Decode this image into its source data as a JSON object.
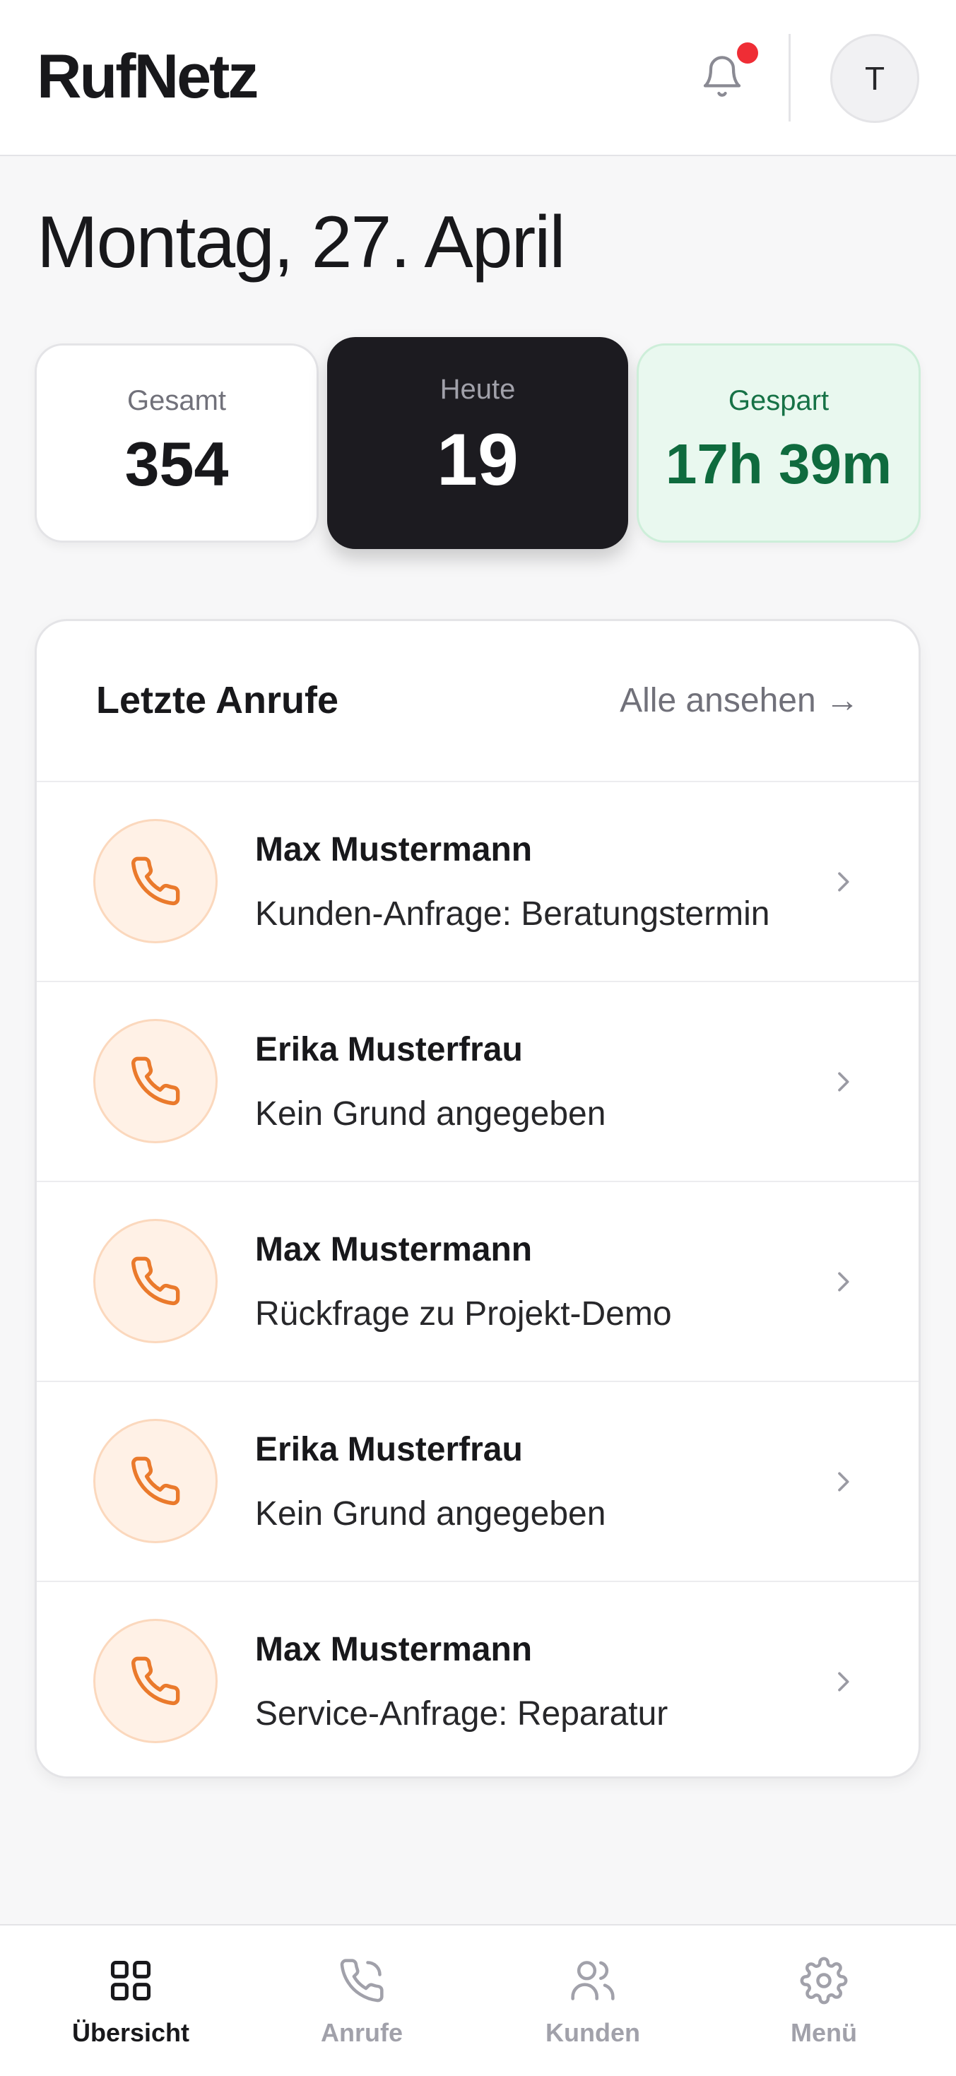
{
  "header": {
    "brand": "RufNetz",
    "avatar_initial": "T",
    "notification_dot_color": "#ef2d35"
  },
  "date_heading": "Montag, 27. April",
  "stats": {
    "total": {
      "label": "Gesamt",
      "value": "354"
    },
    "today": {
      "label": "Heute",
      "value": "19"
    },
    "saved": {
      "label": "Gespart",
      "value": "17h 39m"
    }
  },
  "calls": {
    "title": "Letzte Anrufe",
    "view_all_label": "Alle ansehen →",
    "icon": "phone-icon",
    "accent_color": "#ea7a2c",
    "items": [
      {
        "name": "Max Mustermann",
        "reason": "Kunden-Anfrage: Beratungstermin"
      },
      {
        "name": "Erika Musterfrau",
        "reason": "Kein Grund angegeben"
      },
      {
        "name": "Max Mustermann",
        "reason": "Rückfrage zu Projekt-Demo"
      },
      {
        "name": "Erika Musterfrau",
        "reason": "Kein Grund angegeben"
      },
      {
        "name": "Max Mustermann",
        "reason": "Service-Anfrage: Reparatur"
      }
    ]
  },
  "nav": {
    "items": [
      {
        "label": "Übersicht",
        "icon": "grid-icon",
        "active": true
      },
      {
        "label": "Anrufe",
        "icon": "phone-icon",
        "active": false
      },
      {
        "label": "Kunden",
        "icon": "users-icon",
        "active": false
      },
      {
        "label": "Menü",
        "icon": "gear-icon",
        "active": false
      }
    ]
  }
}
